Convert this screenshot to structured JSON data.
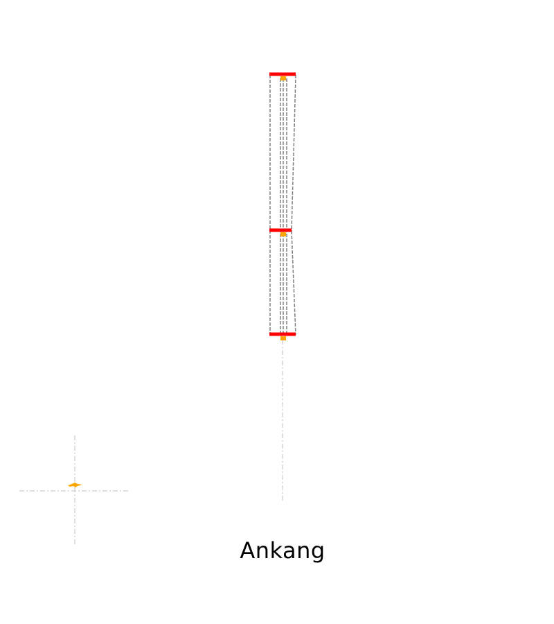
{
  "caption": "Ankang",
  "colors": {
    "background": "#ffffff",
    "frame_dashed": "#808080",
    "guide_dashed": "#cccccc",
    "crossbar": "#ff0000",
    "marker": "#ffa500",
    "text": "#000000"
  },
  "icons": {
    "aircraft_marker": "airplane-icon"
  }
}
